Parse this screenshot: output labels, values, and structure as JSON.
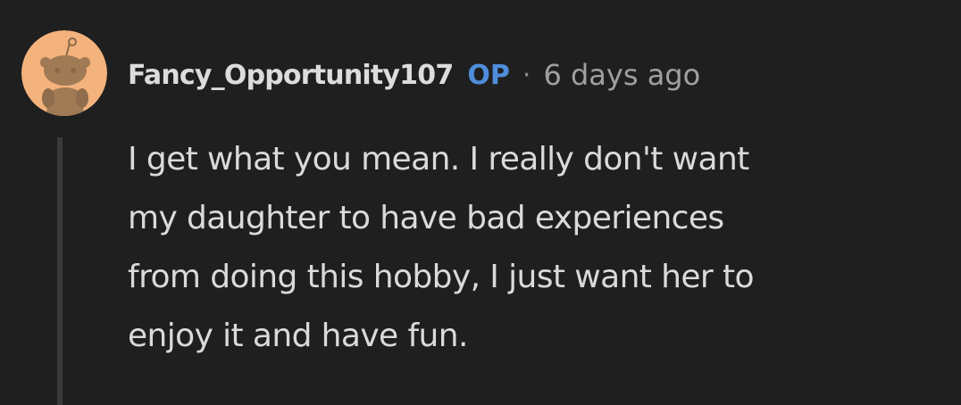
{
  "comment": {
    "author": "Fancy_Opportunity107",
    "badge": "OP",
    "separator": "·",
    "timestamp": "6 days ago",
    "avatar_icon": "snoo-avatar-icon",
    "body_lines": [
      "I get what you mean. I really don't want",
      "my daughter to have bad experiences",
      "from doing this hobby, I just want her to",
      "enjoy it and have fun."
    ]
  },
  "colors": {
    "background": "#1f1f1f",
    "avatar_bg": "#f4b27c",
    "badge": "#4e8ddb",
    "text": "#dadada",
    "meta": "#a0a0a0"
  }
}
